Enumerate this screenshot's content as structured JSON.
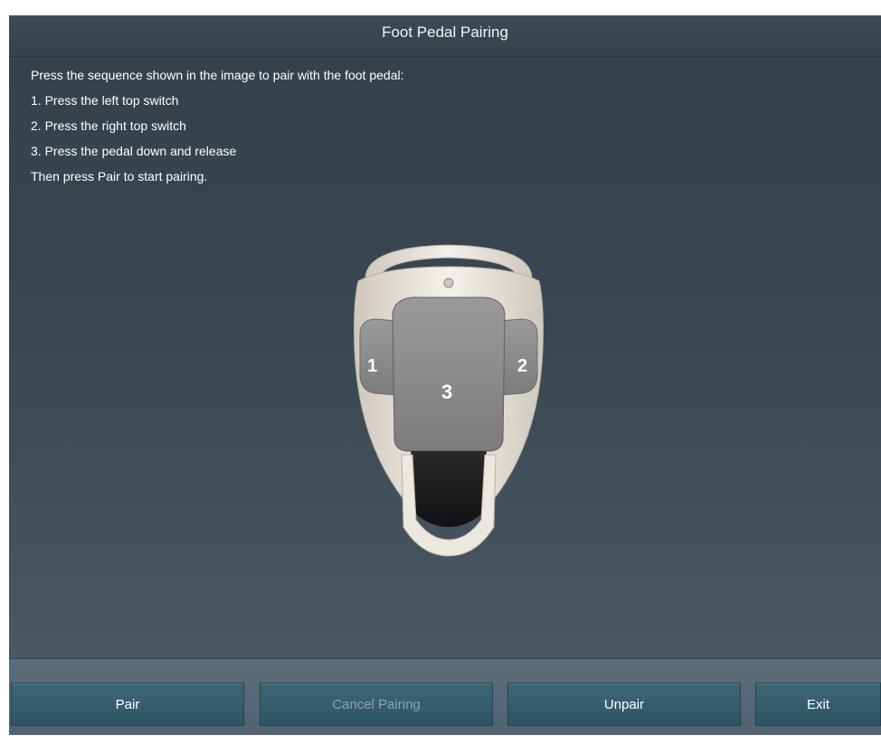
{
  "window": {
    "title": "Foot Pedal Pairing"
  },
  "instructions": {
    "intro": "Press the sequence shown in the image to pair with the foot pedal:",
    "steps": [
      "1.  Press the left top switch",
      "2.  Press the right top switch",
      "3.  Press the pedal down and release"
    ],
    "outro": "Then press Pair to start pairing."
  },
  "pedal_image": {
    "labels": {
      "left_switch": "1",
      "right_switch": "2",
      "pedal": "3"
    }
  },
  "buttons": {
    "pair": "Pair",
    "cancel_pairing": "Cancel Pairing",
    "cancel_pairing_state": "disabled",
    "unpair": "Unpair",
    "exit": "Exit"
  },
  "colors": {
    "background": "#3f4c56",
    "button": "#35596a",
    "disabled_text": "#8fa3ae"
  }
}
